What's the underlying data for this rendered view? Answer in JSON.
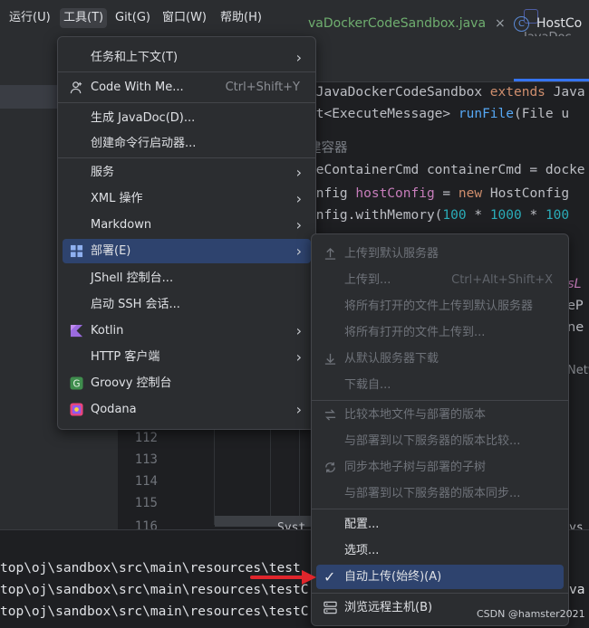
{
  "menubar": {
    "items": [
      "运行(U)",
      "工具(T)",
      "Git(G)",
      "窗口(W)",
      "帮助(H)"
    ],
    "window_title": "JavaDoc"
  },
  "editor": {
    "tabs": [
      {
        "label": "JavaDockerCodeSandbox.java",
        "visible_label": "vaDockerCodeSandbox.java",
        "close": "×"
      },
      {
        "label": "HostCo",
        "icon": "C"
      }
    ],
    "code_lines": [
      {
        "parts": [
          [
            "",
            " JavaDockerCodeSandbox "
          ],
          [
            "kw",
            "extends"
          ],
          [
            "",
            " Java"
          ]
        ]
      },
      {
        "parts": [
          [
            "",
            "st<ExecuteMessage> "
          ],
          [
            "fn",
            "runFile"
          ],
          [
            "",
            "(File u"
          ]
        ]
      },
      {
        "parts": [
          [
            "cm",
            "建容器"
          ]
        ]
      },
      {
        "parts": [
          [
            "",
            "teContainerCmd containerCmd = docke"
          ]
        ]
      },
      {
        "parts": [
          [
            "",
            "onfig "
          ],
          [
            "var",
            "hostConfig"
          ],
          [
            "",
            " = "
          ],
          [
            "kw",
            "new"
          ],
          [
            "",
            " HostConfig"
          ]
        ]
      },
      {
        "parts": [
          [
            "",
            "onfig.withMemory("
          ],
          [
            "num",
            "100"
          ],
          [
            "",
            " * "
          ],
          [
            "num",
            "1000"
          ],
          [
            "",
            " * "
          ],
          [
            "num",
            "100"
          ]
        ]
      }
    ],
    "right_fragments": [
      "sL",
      "eP",
      "ne",
      "Netw"
    ],
    "line_numbers": [
      "112",
      "113",
      "114",
      "115",
      "116"
    ],
    "bottom_fragments": [
      "Syst",
      "ys"
    ]
  },
  "terminal": {
    "lines": [
      "top\\oj\\sandbox\\src\\main\\resources\\test",
      "top\\oj\\sandbox\\src\\main\\resources\\testC",
      "top\\oj\\sandbox\\src\\main\\resources\\testC"
    ],
    "right_tail": "va"
  },
  "watermark": "CSDN @hamster2021",
  "tools_menu": {
    "items": [
      {
        "label": "任务和上下文(T)",
        "submenu": true
      },
      {
        "label": "Code With Me...",
        "shortcut": "Ctrl+Shift+Y",
        "icon": "person-plus-icon"
      },
      {
        "label": "生成 JavaDoc(D)..."
      },
      {
        "label": "创建命令行启动器..."
      },
      {
        "label": "服务",
        "submenu": true
      },
      {
        "label": "XML 操作",
        "submenu": true
      },
      {
        "label": "Markdown",
        "submenu": true
      },
      {
        "label": "部署(E)",
        "submenu": true,
        "icon": "deployment-icon",
        "selected": true
      },
      {
        "label": "JShell 控制台..."
      },
      {
        "label": "启动 SSH 会话..."
      },
      {
        "label": "Kotlin",
        "submenu": true,
        "icon": "kotlin-icon"
      },
      {
        "label": "HTTP 客户端",
        "submenu": true
      },
      {
        "label": "Groovy 控制台",
        "icon": "groovy-icon"
      },
      {
        "label": "Qodana",
        "submenu": true,
        "icon": "qodana-icon"
      }
    ]
  },
  "deploy_menu": {
    "items": [
      {
        "label": "上传到默认服务器",
        "icon": "upload-icon",
        "disabled": true
      },
      {
        "label": "上传到...",
        "shortcut": "Ctrl+Alt+Shift+X",
        "disabled": true
      },
      {
        "label": "将所有打开的文件上传到默认服务器",
        "disabled": true
      },
      {
        "label": "将所有打开的文件上传到...",
        "disabled": true
      },
      {
        "label": "从默认服务器下载",
        "icon": "download-icon",
        "disabled": true
      },
      {
        "label": "下载自...",
        "disabled": true
      },
      {
        "label": "比较本地文件与部署的版本",
        "icon": "compare-icon",
        "disabled": true
      },
      {
        "label": "与部署到以下服务器的版本比较...",
        "disabled": true
      },
      {
        "label": "同步本地子树与部署的子树",
        "icon": "sync-icon",
        "disabled": true
      },
      {
        "label": "与部署到以下服务器的版本同步...",
        "disabled": true
      },
      {
        "label": "配置..."
      },
      {
        "label": "选项..."
      },
      {
        "label": "自动上传(始终)(A)",
        "checked": true,
        "selected": true,
        "check": "✓"
      },
      {
        "label": "浏览远程主机(B)",
        "icon": "remote-host-icon"
      }
    ]
  },
  "colors": {
    "accent": "#3574f0",
    "selection": "#2e436e",
    "annotation_arrow": "#e0262c"
  }
}
